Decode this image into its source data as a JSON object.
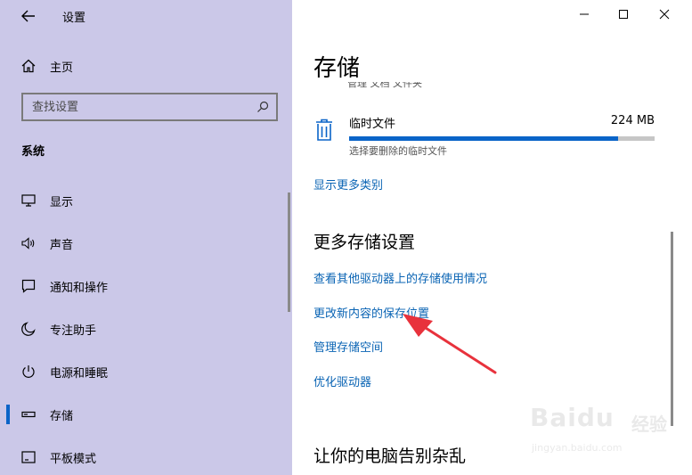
{
  "window": {
    "title": "设置",
    "controls": {
      "minimize": "minimize-icon",
      "maximize": "maximize-icon",
      "close": "close-icon"
    }
  },
  "sidebar": {
    "home_label": "主页",
    "search_placeholder": "查找设置",
    "section_title": "系统",
    "items": [
      {
        "label": "显示",
        "icon": "monitor-icon"
      },
      {
        "label": "声音",
        "icon": "speaker-icon"
      },
      {
        "label": "通知和操作",
        "icon": "notification-icon"
      },
      {
        "label": "专注助手",
        "icon": "moon-icon"
      },
      {
        "label": "电源和睡眠",
        "icon": "power-icon"
      },
      {
        "label": "存储",
        "icon": "storage-icon",
        "selected": true
      },
      {
        "label": "平板模式",
        "icon": "tablet-icon"
      }
    ]
  },
  "main": {
    "title": "存储",
    "clipped_text": "管理 文档 文件夹",
    "temp_files": {
      "title": "临时文件",
      "size": "224 MB",
      "usage_fraction": 0.88,
      "description": "选择要删除的临时文件"
    },
    "show_more_link": "显示更多类别",
    "more_settings": {
      "title": "更多存储设置",
      "links": [
        "查看其他驱动器上的存储使用情况",
        "更改新内容的保存位置",
        "管理存储空间",
        "优化驱动器"
      ]
    },
    "clutter_title": "让你的电脑告别杂乱"
  },
  "watermark": {
    "logo_text": "Baidu",
    "sub_text": "经验",
    "url": "jingyan.baidu.com"
  },
  "colors": {
    "sidebar_bg": "#cbc8e8",
    "accent": "#0a64c8",
    "link": "#0a64b4",
    "annotation_arrow": "#e8323c"
  }
}
